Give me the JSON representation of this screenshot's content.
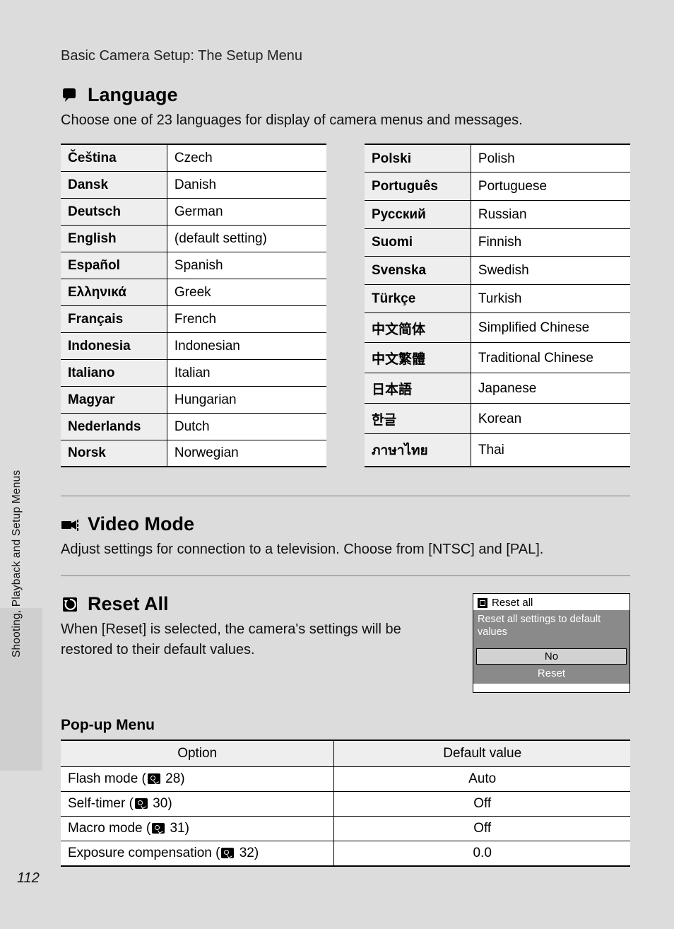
{
  "chapter": "Basic Camera Setup: The Setup Menu",
  "sideText": "Shooting, Playback and Setup Menus",
  "pageNumber": "112",
  "language": {
    "title": "Language",
    "desc": "Choose one of 23 languages for display of camera menus and messages.",
    "left": [
      {
        "native": "Čeština",
        "eng": "Czech"
      },
      {
        "native": "Dansk",
        "eng": "Danish"
      },
      {
        "native": "Deutsch",
        "eng": "German"
      },
      {
        "native": "English",
        "eng": "(default setting)"
      },
      {
        "native": "Español",
        "eng": "Spanish"
      },
      {
        "native": "Ελληνικά",
        "eng": "Greek"
      },
      {
        "native": "Français",
        "eng": "French"
      },
      {
        "native": "Indonesia",
        "eng": "Indonesian"
      },
      {
        "native": "Italiano",
        "eng": "Italian"
      },
      {
        "native": "Magyar",
        "eng": "Hungarian"
      },
      {
        "native": "Nederlands",
        "eng": "Dutch"
      },
      {
        "native": "Norsk",
        "eng": "Norwegian"
      }
    ],
    "right": [
      {
        "native": "Polski",
        "eng": "Polish"
      },
      {
        "native": "Português",
        "eng": "Portuguese"
      },
      {
        "native": "Русский",
        "eng": "Russian"
      },
      {
        "native": "Suomi",
        "eng": "Finnish"
      },
      {
        "native": "Svenska",
        "eng": "Swedish"
      },
      {
        "native": "Türkçe",
        "eng": "Turkish"
      },
      {
        "native": "中文简体",
        "eng": "Simplified Chinese"
      },
      {
        "native": "中文繁體",
        "eng": "Traditional Chinese"
      },
      {
        "native": "日本語",
        "eng": "Japanese"
      },
      {
        "native": "한글",
        "eng": "Korean"
      },
      {
        "native": "ภาษาไทย",
        "eng": "Thai"
      }
    ]
  },
  "videoMode": {
    "title": "Video Mode",
    "desc": "Adjust settings for connection to a television. Choose from [NTSC] and [PAL]."
  },
  "resetAll": {
    "title": "Reset All",
    "desc": "When [Reset] is selected, the camera's settings will be restored to their default values.",
    "lcd": {
      "title": "Reset all",
      "message": "Reset all settings to default values",
      "optNo": "No",
      "optReset": "Reset"
    }
  },
  "popup": {
    "heading": "Pop-up Menu",
    "headers": {
      "option": "Option",
      "value": "Default value"
    },
    "rows": [
      {
        "label": "Flash mode (",
        "ref": "28",
        "suffix": ")",
        "value": "Auto"
      },
      {
        "label": "Self-timer (",
        "ref": "30",
        "suffix": ")",
        "value": "Off"
      },
      {
        "label": "Macro mode (",
        "ref": "31",
        "suffix": ")",
        "value": "Off"
      },
      {
        "label": "Exposure compensation (",
        "ref": "32",
        "suffix": ")",
        "value": "0.0"
      }
    ]
  }
}
